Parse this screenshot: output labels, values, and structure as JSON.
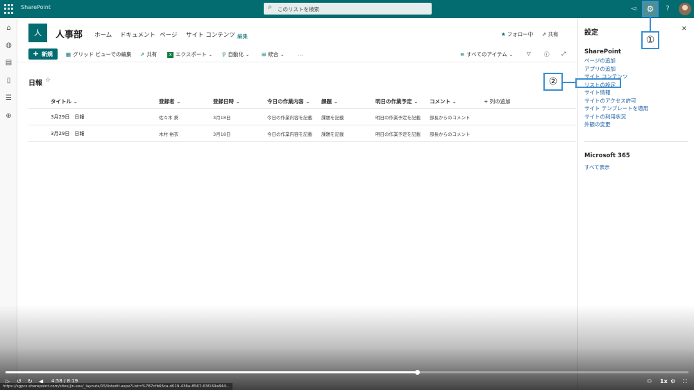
{
  "suite": {
    "brand": "SharePoint",
    "search_placeholder": "このリストを検索"
  },
  "site": {
    "logo_letter": "人",
    "title": "人事部",
    "nav": [
      "ホーム",
      "ドキュメント",
      "ページ",
      "サイト コンテンツ"
    ],
    "edit": "編集",
    "follow": "フォロー中",
    "share": "共有"
  },
  "command_bar": {
    "new": "新規",
    "grid_edit": "グリッド ビューでの編集",
    "share": "共有",
    "export": "エクスポート",
    "automate": "自動化",
    "integrate": "統合",
    "more": "…",
    "view": "すべてのアイテム"
  },
  "list": {
    "title": "日報",
    "columns": [
      "タイトル",
      "登録者",
      "登録日時",
      "今日の作業内容",
      "課題",
      "明日の作業予定",
      "コメント"
    ],
    "add_column": "列の追加",
    "rows": [
      {
        "title": "3月29日　日報",
        "author": "佐々木 葵",
        "date": "3月18日",
        "today": "今日の作業内容を記載",
        "issue": "課題を記載",
        "tomorrow": "明日の作業予定を記載",
        "comment": "部長からのコメント"
      },
      {
        "title": "3月29日　日報",
        "author": "木村 裕衣",
        "date": "3月18日",
        "today": "今日の作業内容を記載",
        "issue": "課題を記載",
        "tomorrow": "明日の作業予定を記載",
        "comment": "部長からのコメント"
      }
    ]
  },
  "settings_panel": {
    "title": "設定",
    "section_sharepoint": "SharePoint",
    "links": [
      "ページの追加",
      "アプリの追加",
      "サイト コンテンツ",
      "リストの設定",
      "サイト情報",
      "サイトのアクセス許可",
      "サイト テンプレートを適用",
      "サイトの利用状況",
      "外観の変更"
    ],
    "section_m365": "Microsoft 365",
    "see_all": "すべて表示"
  },
  "callouts": {
    "one": "①",
    "two": "②"
  },
  "video": {
    "time": "4:58 / 8:19",
    "progress": 0.603,
    "speed": "1x",
    "status_url": "https://sgpcs.sharepoint.com/sites/jin-sou/_layouts/15/listedit.aspx?List=%7B7cfb66ca-d019-436a-8567-63f169a844..."
  },
  "colors": {
    "suitebar": "#036c70",
    "accent": "#036c70",
    "link": "#1b5fa5",
    "callout_border": "#3b8fd0"
  }
}
